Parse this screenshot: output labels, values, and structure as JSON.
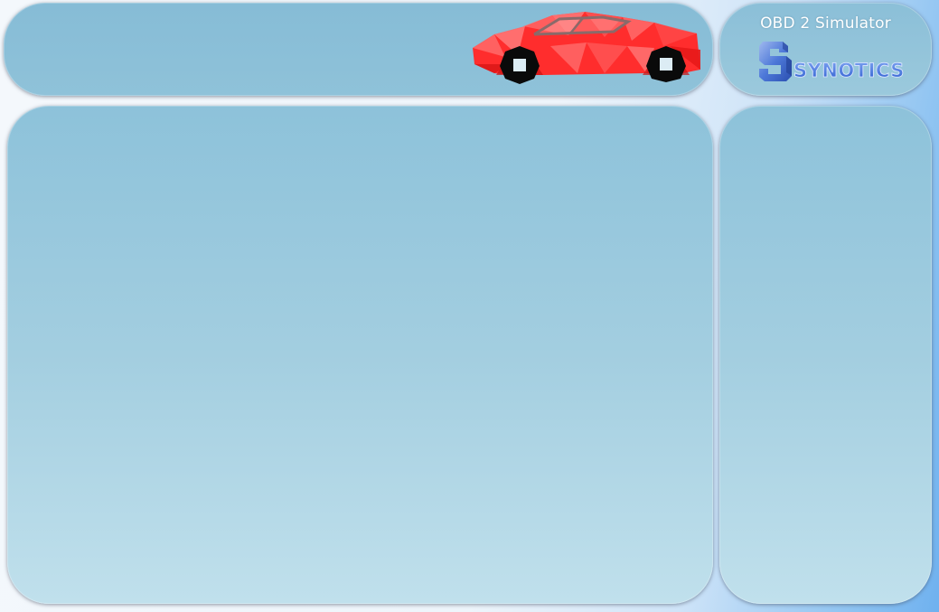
{
  "app": {
    "title": "OBD 2 Simulator",
    "logo_text": "SYNOTICS"
  },
  "icons": {
    "vehicle": "red-sports-car-icon",
    "logo": "synotics-s-logo-icon"
  },
  "colors": {
    "panel": "#8fc2d9",
    "car_body": "#ff2a2a",
    "logo_blue": "#3b6fd8"
  }
}
